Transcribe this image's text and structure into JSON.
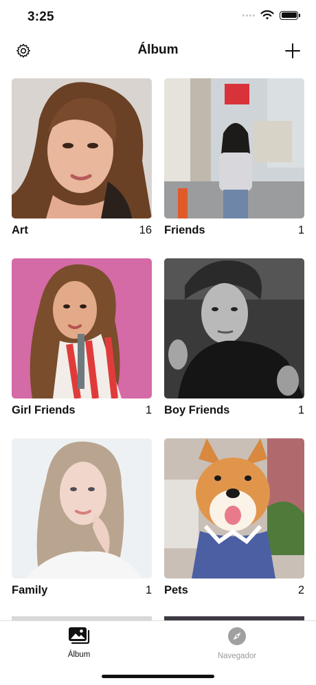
{
  "status_bar": {
    "time": "3:25"
  },
  "nav": {
    "title": "Álbum",
    "left_icon": "gear-icon",
    "right_icon": "plus-icon"
  },
  "albums": [
    {
      "name": "Art",
      "count": "16"
    },
    {
      "name": "Friends",
      "count": "1"
    },
    {
      "name": "Girl Friends",
      "count": "1"
    },
    {
      "name": "Boy Friends",
      "count": "1"
    },
    {
      "name": "Family",
      "count": "1"
    },
    {
      "name": "Pets",
      "count": "2"
    }
  ],
  "tabs": [
    {
      "label": "Álbum",
      "icon": "photos-icon",
      "active": true
    },
    {
      "label": "Navegador",
      "icon": "compass-icon",
      "active": false
    }
  ],
  "colors": {
    "active_tab": "#111111",
    "inactive_tab": "#9a9a9a",
    "background": "#ffffff"
  }
}
